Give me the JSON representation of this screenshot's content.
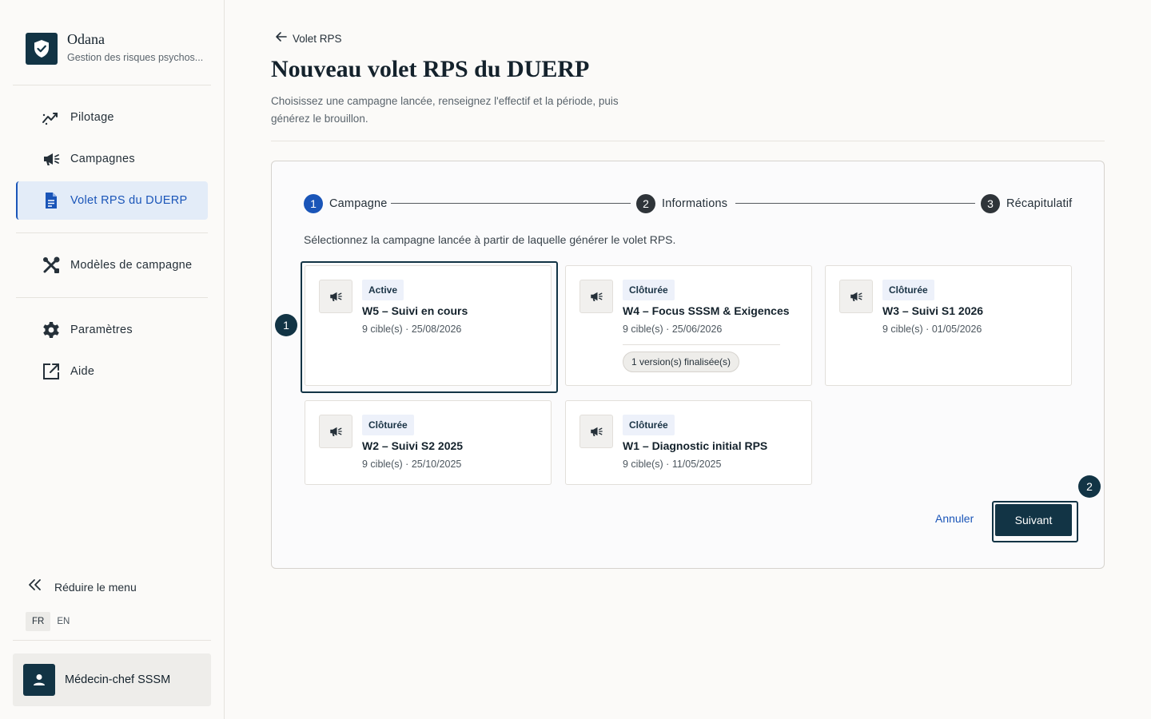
{
  "brand": {
    "name": "Odana",
    "subtitle": "Gestion des risques psychos..."
  },
  "nav": {
    "pilotage": "Pilotage",
    "campagnes": "Campagnes",
    "volet": "Volet RPS du DUERP",
    "modeles": "Modèles de campagne",
    "parametres": "Paramètres",
    "aide": "Aide"
  },
  "sidebar": {
    "collapse_label": "Réduire le menu",
    "lang_fr": "FR",
    "lang_en": "EN",
    "user_name": "Médecin-chef SSSM"
  },
  "header": {
    "back_label": "Volet RPS",
    "title": "Nouveau volet RPS du DUERP",
    "subtitle": "Choisissez une campagne lancée, renseignez l'effectif et la période, puis générez le brouillon."
  },
  "stepper": {
    "steps": [
      {
        "num": "1",
        "label": "Campagne"
      },
      {
        "num": "2",
        "label": "Informations"
      },
      {
        "num": "3",
        "label": "Récapitulatif"
      }
    ]
  },
  "instruction": "Sélectionnez la campagne lancée à partir de laquelle générer le volet RPS.",
  "campaigns": [
    {
      "status": "Active",
      "name": "W5 – Suivi en cours",
      "meta": "9 cible(s) · 25/08/2026"
    },
    {
      "status": "Clôturée",
      "name": "W4 – Focus SSSM & Exigences",
      "meta": "9 cible(s) · 25/06/2026",
      "chip": "1 version(s) finalisée(s)"
    },
    {
      "status": "Clôturée",
      "name": "W3 – Suivi S1 2026",
      "meta": "9 cible(s) · 01/05/2026"
    },
    {
      "status": "Clôturée",
      "name": "W2 – Suivi S2 2025",
      "meta": "9 cible(s) · 25/10/2025"
    },
    {
      "status": "Clôturée",
      "name": "W1 – Diagnostic initial RPS",
      "meta": "9 cible(s) · 11/05/2025"
    }
  ],
  "markers": {
    "first": "1",
    "second": "2"
  },
  "actions": {
    "cancel": "Annuler",
    "next": "Suivant"
  },
  "colors": {
    "primary": "#123445",
    "accent": "#1a55b8",
    "active_nav_bg": "#e3ecf8"
  }
}
